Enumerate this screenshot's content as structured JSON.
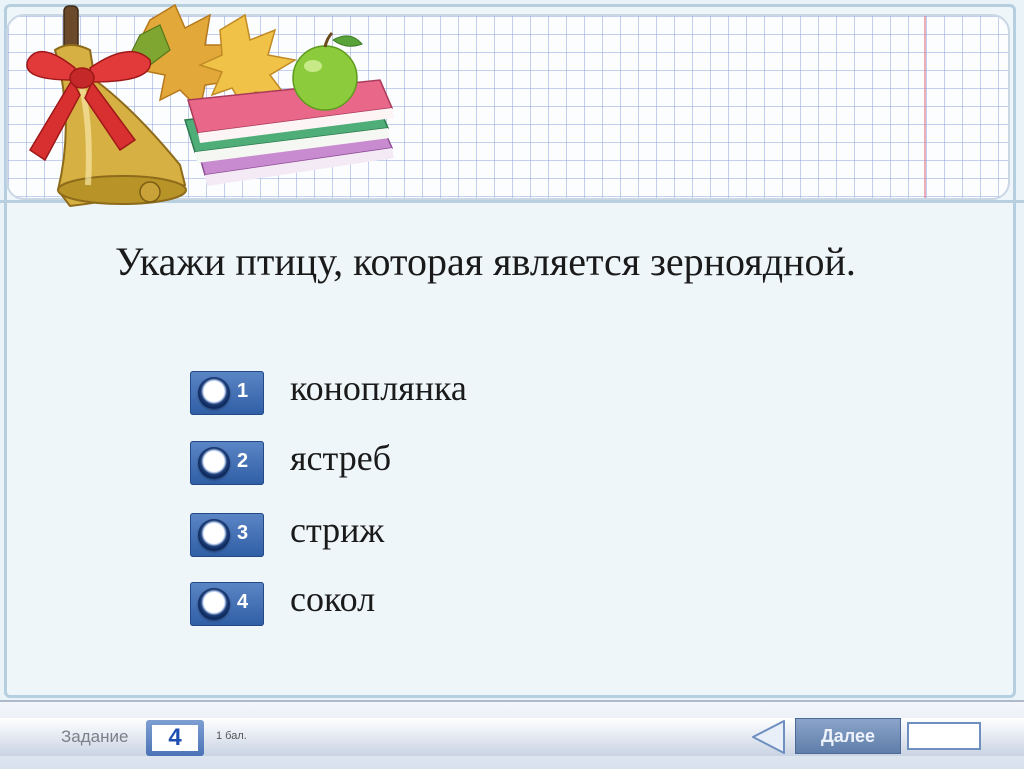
{
  "question": {
    "text": "Укажи птицу, которая является зерноядной."
  },
  "options": [
    {
      "number": "1",
      "label": "коноплянка"
    },
    {
      "number": "2",
      "label": "ястреб"
    },
    {
      "number": "3",
      "label": "стриж"
    },
    {
      "number": "4",
      "label": "сокол"
    }
  ],
  "footer": {
    "task_label": "Задание",
    "task_number": "4",
    "points": "1 бал.",
    "next_label": "Далее",
    "answer_value": ""
  },
  "colors": {
    "button_blue": "#2f5ea5",
    "grid_blue": "#96aae1",
    "task_number": "#1e4fb0"
  },
  "icons": [
    "bell-icon",
    "ribbon-bow-icon",
    "maple-leaves-icon",
    "books-stack-icon",
    "apple-icon",
    "radio-icon",
    "back-arrow-icon"
  ]
}
